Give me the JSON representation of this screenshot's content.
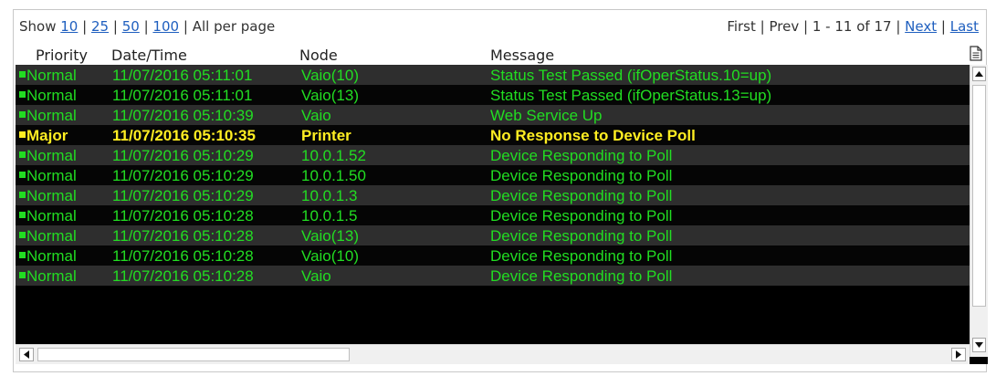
{
  "pager": {
    "show_label": "Show",
    "page_sizes": [
      "10",
      "25",
      "50",
      "100"
    ],
    "all_label": "All",
    "per_page_label": "per page",
    "first_label": "First",
    "prev_label": "Prev",
    "range_text": "1 - 11 of 17",
    "next_label": "Next",
    "last_label": "Last"
  },
  "columns": {
    "priority": "Priority",
    "datetime": "Date/Time",
    "node": "Node",
    "message": "Message"
  },
  "icons": {
    "export": "document-icon",
    "scroll_up": "arrow-up-icon",
    "scroll_down": "arrow-down-icon",
    "scroll_left": "arrow-left-icon",
    "scroll_right": "arrow-right-icon"
  },
  "colors": {
    "normal": "#22dd22",
    "major": "#ffee22",
    "row_even": "#2e2e2e",
    "row_odd": "#050505",
    "link": "#1f5fbf"
  },
  "rows": [
    {
      "priority": "Normal",
      "datetime": "11/07/2016 05:11:01",
      "node": "Vaio(10)",
      "message": "Status Test Passed (ifOperStatus.10=up)"
    },
    {
      "priority": "Normal",
      "datetime": "11/07/2016 05:11:01",
      "node": "Vaio(13)",
      "message": "Status Test Passed (ifOperStatus.13=up)"
    },
    {
      "priority": "Normal",
      "datetime": "11/07/2016 05:10:39",
      "node": "Vaio",
      "message": "Web Service Up"
    },
    {
      "priority": "Major",
      "datetime": "11/07/2016 05:10:35",
      "node": "Printer",
      "message": "No Response to Device Poll"
    },
    {
      "priority": "Normal",
      "datetime": "11/07/2016 05:10:29",
      "node": "10.0.1.52",
      "message": "Device Responding to Poll"
    },
    {
      "priority": "Normal",
      "datetime": "11/07/2016 05:10:29",
      "node": "10.0.1.50",
      "message": "Device Responding to Poll"
    },
    {
      "priority": "Normal",
      "datetime": "11/07/2016 05:10:29",
      "node": "10.0.1.3",
      "message": "Device Responding to Poll"
    },
    {
      "priority": "Normal",
      "datetime": "11/07/2016 05:10:28",
      "node": "10.0.1.5",
      "message": "Device Responding to Poll"
    },
    {
      "priority": "Normal",
      "datetime": "11/07/2016 05:10:28",
      "node": "Vaio(13)",
      "message": "Device Responding to Poll"
    },
    {
      "priority": "Normal",
      "datetime": "11/07/2016 05:10:28",
      "node": "Vaio(10)",
      "message": "Device Responding to Poll"
    },
    {
      "priority": "Normal",
      "datetime": "11/07/2016 05:10:28",
      "node": "Vaio",
      "message": "Device Responding to Poll"
    }
  ]
}
